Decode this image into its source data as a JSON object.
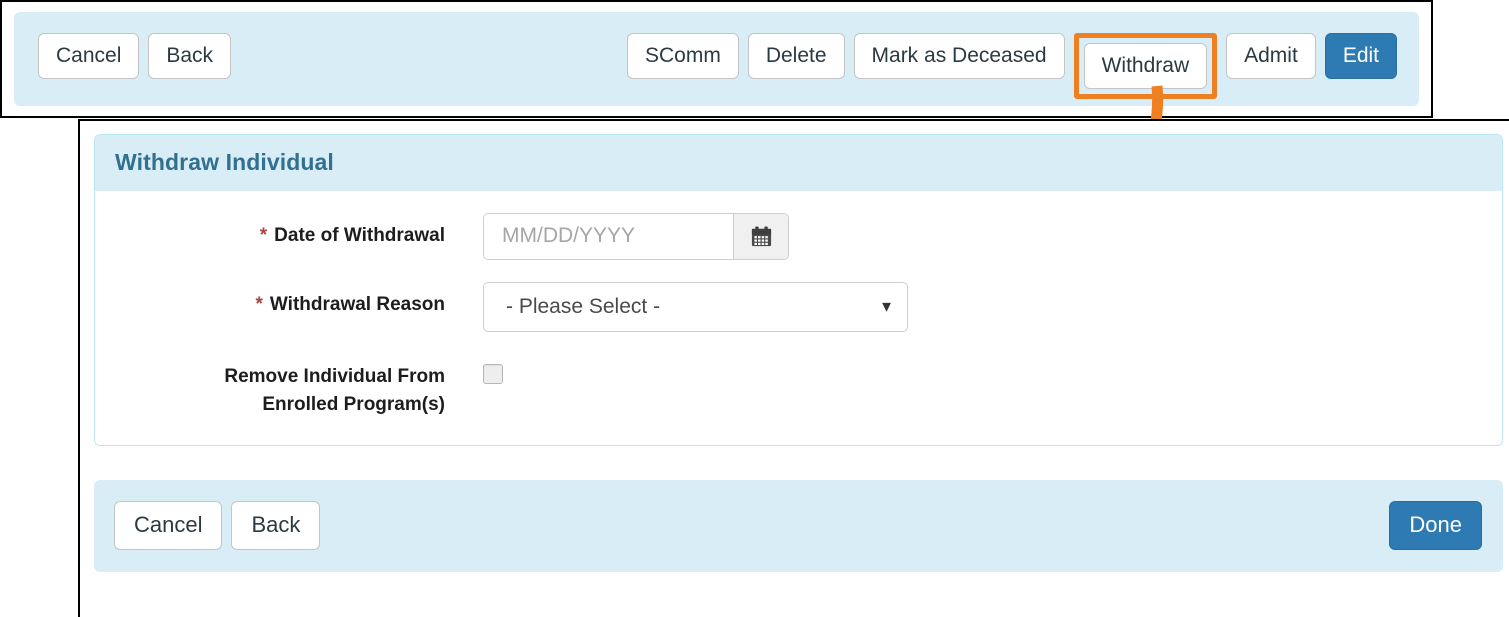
{
  "toolbar": {
    "left_buttons": [
      {
        "label": "Cancel",
        "name": "cancel-button"
      },
      {
        "label": "Back",
        "name": "back-button"
      }
    ],
    "right_buttons": [
      {
        "label": "SComm",
        "name": "scomm-button"
      },
      {
        "label": "Delete",
        "name": "delete-button"
      },
      {
        "label": "Mark as Deceased",
        "name": "mark-as-deceased-button"
      }
    ],
    "withdraw_label": "Withdraw",
    "admit_label": "Admit",
    "edit_label": "Edit"
  },
  "annotation": {
    "kind": "curved-arrow",
    "color": "#ef8022",
    "highlight_target": "Withdraw"
  },
  "dialog": {
    "title": "Withdraw Individual",
    "fields": {
      "date_of_withdrawal": {
        "label": "Date of Withdrawal",
        "required_marker": "*",
        "value": "",
        "placeholder": "MM/DD/YYYY",
        "addon_icon": "calendar-icon"
      },
      "withdrawal_reason": {
        "label": "Withdrawal Reason",
        "required_marker": "*",
        "selected": "- Please Select -",
        "options": [
          "- Please Select -"
        ],
        "caret_icon": "chevron-down-icon"
      },
      "remove_from_programs": {
        "label_line1": "Remove Individual From",
        "label_line2": "Enrolled Program(s)",
        "checked": false
      }
    },
    "footer": {
      "cancel_label": "Cancel",
      "back_label": "Back",
      "done_label": "Done"
    }
  },
  "colors": {
    "panel_blue": "#d9edf7",
    "panel_border": "#bce8f1",
    "title_blue": "#31708f",
    "primary_button": "#2e7bb3",
    "required_red": "#a94442",
    "annotation_orange": "#ef8022"
  }
}
